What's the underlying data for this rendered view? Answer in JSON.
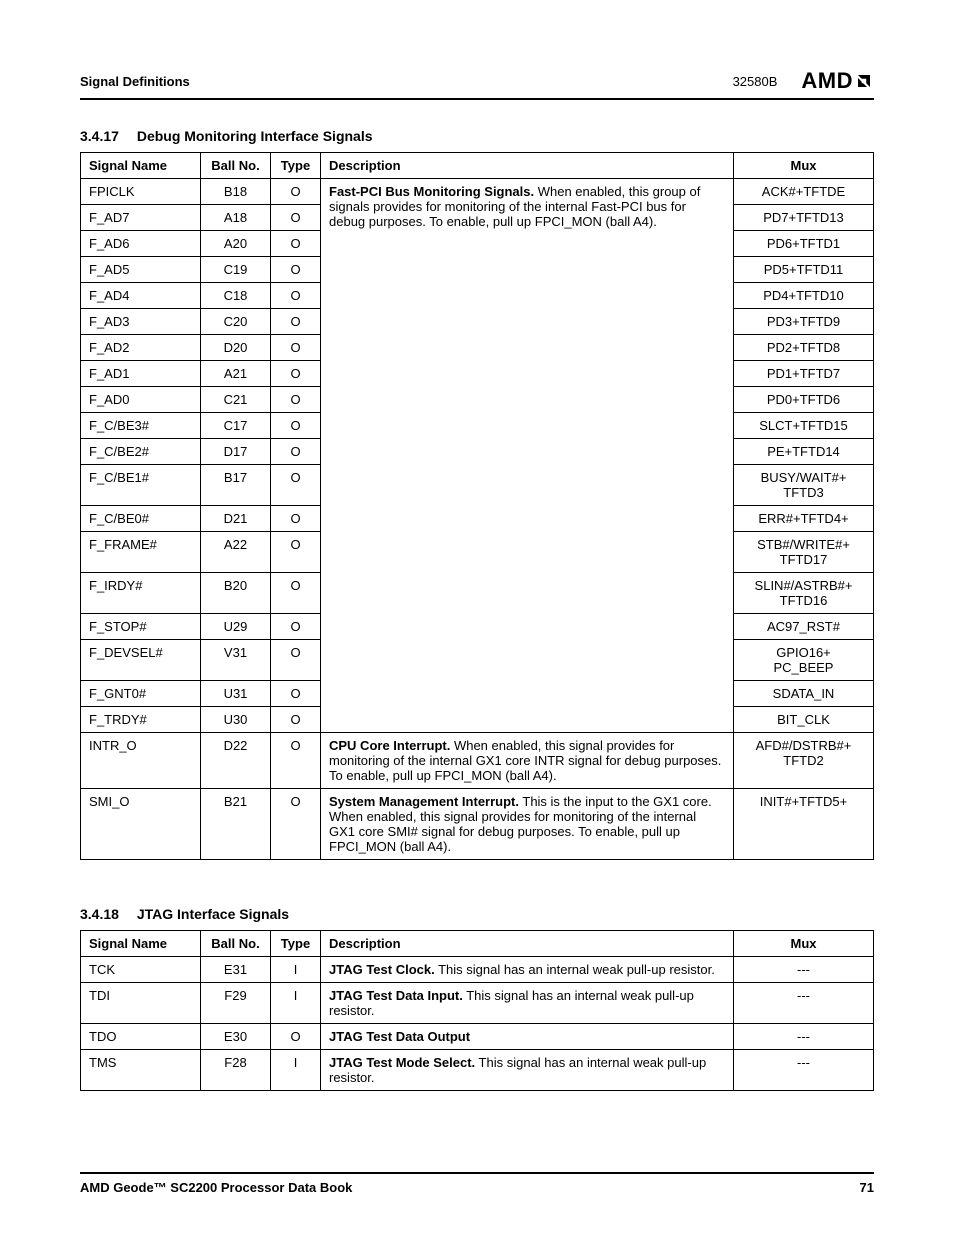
{
  "header": {
    "left": "Signal Definitions",
    "docnum": "32580B",
    "logo": "AMD"
  },
  "section1": {
    "num": "3.4.17",
    "title": "Debug Monitoring Interface Signals",
    "columns": [
      "Signal Name",
      "Ball No.",
      "Type",
      "Description",
      "Mux"
    ],
    "desc_fastpci_lead": "Fast-PCI Bus Monitoring Signals.",
    "desc_fastpci_rest": " When enabled, this group of signals provides for monitoring of the internal Fast-PCI bus for debug purposes. To enable, pull up FPCI_MON (ball A4).",
    "desc_intr_lead": "CPU Core Interrupt.",
    "desc_intr_rest": " When enabled, this signal provides for monitoring of the internal GX1 core INTR signal for debug purposes. To enable, pull up FPCI_MON (ball A4).",
    "desc_smi_lead": "System Management Interrupt.",
    "desc_smi_rest": " This is the input to the GX1 core. When enabled, this signal provides for monitoring of the internal GX1 core SMI# signal for debug purposes. To enable, pull up FPCI_MON (ball A4).",
    "rows": [
      {
        "sig": "FPICLK",
        "ball": "B18",
        "type": "O",
        "mux": "ACK#+TFTDE"
      },
      {
        "sig": "F_AD7",
        "ball": "A18",
        "type": "O",
        "mux": "PD7+TFTD13"
      },
      {
        "sig": "F_AD6",
        "ball": "A20",
        "type": "O",
        "mux": "PD6+TFTD1"
      },
      {
        "sig": "F_AD5",
        "ball": "C19",
        "type": "O",
        "mux": "PD5+TFTD11"
      },
      {
        "sig": "F_AD4",
        "ball": "C18",
        "type": "O",
        "mux": "PD4+TFTD10"
      },
      {
        "sig": "F_AD3",
        "ball": "C20",
        "type": "O",
        "mux": "PD3+TFTD9"
      },
      {
        "sig": "F_AD2",
        "ball": "D20",
        "type": "O",
        "mux": "PD2+TFTD8"
      },
      {
        "sig": "F_AD1",
        "ball": "A21",
        "type": "O",
        "mux": "PD1+TFTD7"
      },
      {
        "sig": "F_AD0",
        "ball": "C21",
        "type": "O",
        "mux": "PD0+TFTD6"
      },
      {
        "sig": "F_C/BE3#",
        "ball": "C17",
        "type": "O",
        "mux": "SLCT+TFTD15"
      },
      {
        "sig": "F_C/BE2#",
        "ball": "D17",
        "type": "O",
        "mux": "PE+TFTD14"
      },
      {
        "sig": "F_C/BE1#",
        "ball": "B17",
        "type": "O",
        "mux": "BUSY/WAIT#+\nTFTD3"
      },
      {
        "sig": "F_C/BE0#",
        "ball": "D21",
        "type": "O",
        "mux": "ERR#+TFTD4+"
      },
      {
        "sig": "F_FRAME#",
        "ball": "A22",
        "type": "O",
        "mux": "STB#/WRITE#+\nTFTD17"
      },
      {
        "sig": "F_IRDY#",
        "ball": "B20",
        "type": "O",
        "mux": "SLIN#/ASTRB#+\nTFTD16"
      },
      {
        "sig": "F_STOP#",
        "ball": "U29",
        "type": "O",
        "mux": "AC97_RST#"
      },
      {
        "sig": "F_DEVSEL#",
        "ball": "V31",
        "type": "O",
        "mux": "GPIO16+\nPC_BEEP"
      },
      {
        "sig": "F_GNT0#",
        "ball": "U31",
        "type": "O",
        "mux": "SDATA_IN"
      },
      {
        "sig": "F_TRDY#",
        "ball": "U30",
        "type": "O",
        "mux": "BIT_CLK"
      },
      {
        "sig": "INTR_O",
        "ball": "D22",
        "type": "O",
        "mux": "AFD#/DSTRB#+\nTFTD2"
      },
      {
        "sig": "SMI_O",
        "ball": "B21",
        "type": "O",
        "mux": "INIT#+TFTD5+"
      }
    ]
  },
  "section2": {
    "num": "3.4.18",
    "title": "JTAG Interface Signals",
    "columns": [
      "Signal Name",
      "Ball No.",
      "Type",
      "Description",
      "Mux"
    ],
    "rows": [
      {
        "sig": "TCK",
        "ball": "E31",
        "type": "I",
        "lead": "JTAG Test Clock.",
        "rest": " This signal has an internal weak pull-up resistor.",
        "mux": "---"
      },
      {
        "sig": "TDI",
        "ball": "F29",
        "type": "I",
        "lead": "JTAG Test Data Input.",
        "rest": " This signal has an internal weak pull-up resistor.",
        "mux": "---"
      },
      {
        "sig": "TDO",
        "ball": "E30",
        "type": "O",
        "lead": "JTAG Test Data Output",
        "rest": "",
        "mux": "---"
      },
      {
        "sig": "TMS",
        "ball": "F28",
        "type": "I",
        "lead": "JTAG Test Mode Select.",
        "rest": " This signal has an internal weak pull-up resistor.",
        "mux": "---"
      }
    ]
  },
  "footer": {
    "left": "AMD Geode™ SC2200  Processor Data Book",
    "right": "71"
  }
}
